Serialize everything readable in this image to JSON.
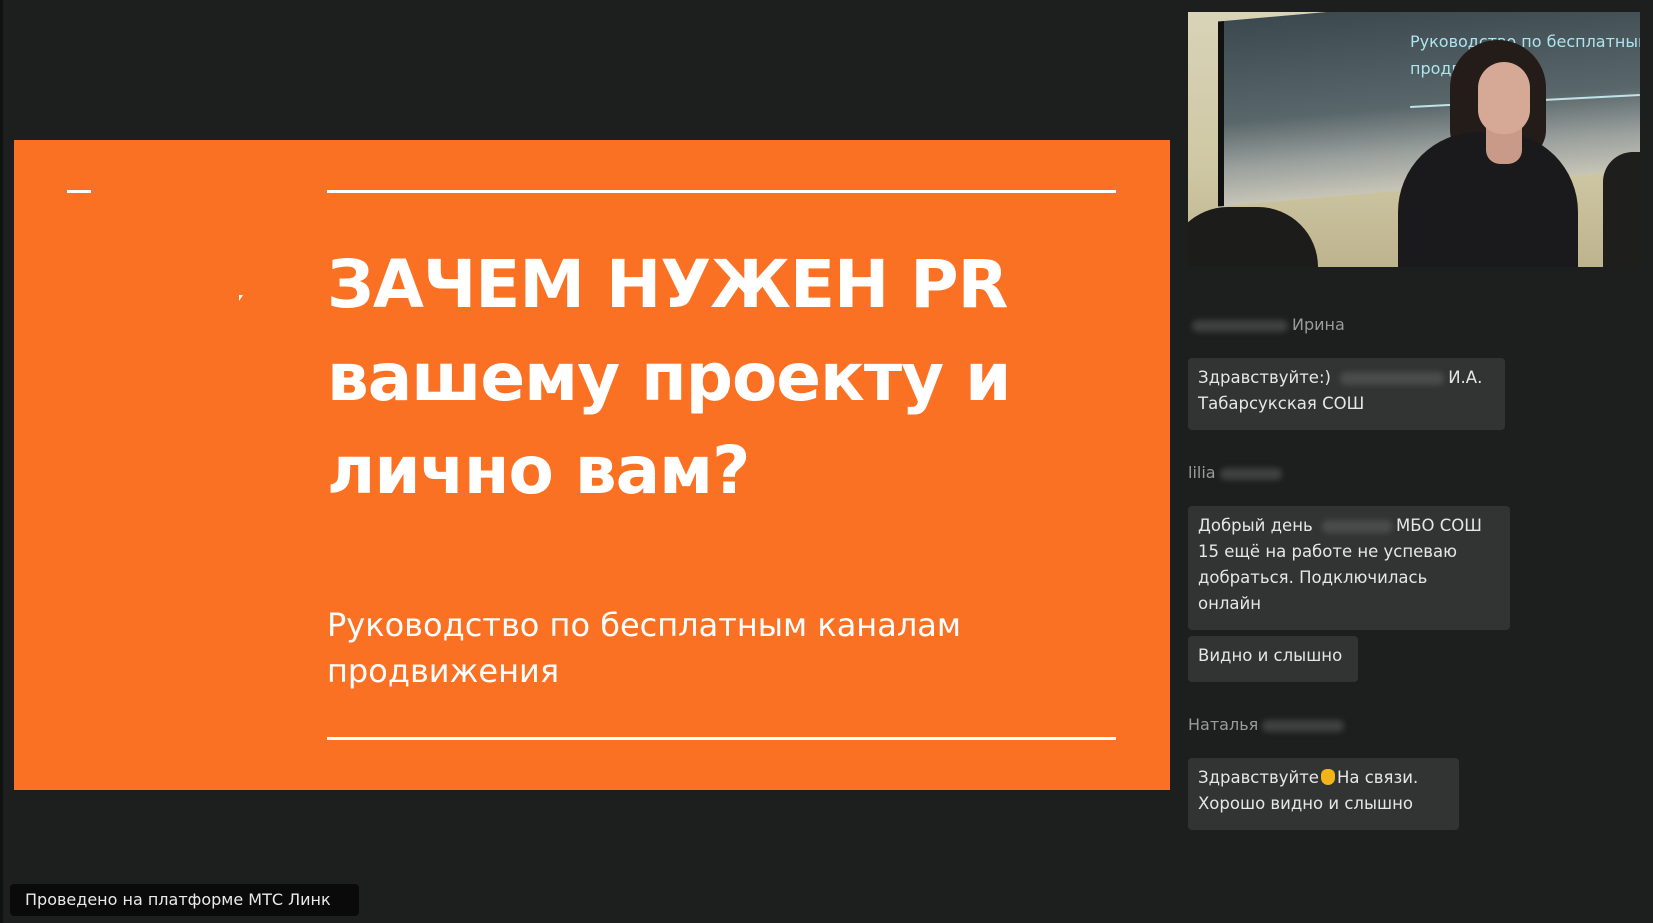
{
  "slide": {
    "title_lines": [
      "ЗАЧЕМ НУЖЕН PR",
      "вашему проекту и",
      "лично вам?"
    ],
    "subtitle_lines": [
      "Руководство по бесплатным каналам",
      "продвижения"
    ],
    "background_color": "#fb7124"
  },
  "video": {
    "screen_text_lines": [
      "Руководство по бесплатным ",
      "продви"
    ]
  },
  "chat": {
    "messages": [
      {
        "name": "Ирина",
        "bubbles": [
          {
            "lines": [
              [
                "Здравствуйте:) ",
                "И.А."
              ],
              [
                "Табарсукская СОШ"
              ]
            ]
          }
        ]
      },
      {
        "name": "lilia",
        "bubbles": [
          {
            "lines": [
              [
                "Добрый день ",
                "МБО СОШ"
              ],
              [
                "15 ещё на работе не успеваю"
              ],
              [
                "добраться. Подключилась"
              ],
              [
                "онлайн"
              ]
            ]
          },
          {
            "lines": [
              [
                "Видно и слышно"
              ]
            ]
          }
        ]
      },
      {
        "name": "Наталья",
        "bubbles": [
          {
            "lines": [
              [
                "Здравствуйте",
                "На связи."
              ],
              [
                "Хорошо видно и слышно"
              ]
            ]
          }
        ]
      }
    ]
  },
  "footer": {
    "platform_label": "Проведено на платформе МТС Линк"
  },
  "icons": {
    "cursor": "mouse-cursor-icon",
    "emoji": "waving-hand-icon"
  }
}
